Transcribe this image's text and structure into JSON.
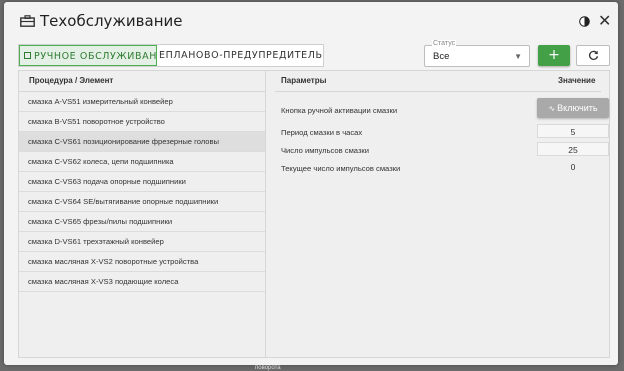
{
  "dialog": {
    "title": "Техобслуживание",
    "close_label": "✕"
  },
  "tabs": {
    "manual": "Ручное обслуживание",
    "planned": "еПЛАНОВО-ПРЕДУПРЕДИТЕЛЬНОЕ"
  },
  "status_filter": {
    "legend": "Статус",
    "value": "Все"
  },
  "toolbar": {
    "add_label": "+"
  },
  "left_table": {
    "header": "Процедура / Элемент",
    "selected_index": 2,
    "rows": [
      "смазка А-VS51 измерительный конвейер",
      "смазка В-VS51 поворотное устройство",
      "смазка С-VS61 позиционирование фрезерные головы",
      "смазка С-VS62 колеса, цепи подшипника",
      "смазка С-VS63 подача опорные подшипники",
      "смазка С-VS64 SE/вытягивание опорные подшипники",
      "смазка С-VS65 фрезы/пилы подшипники",
      "смазка D-VS61 трехэтажный конвейер",
      "смазка масляная X-VS2 поворотные устройства",
      "смазка масляная X-VS3 подающие колеса"
    ]
  },
  "right_table": {
    "header_param": "Параметры",
    "header_value": "Значение",
    "rows": [
      {
        "label": "Кнопка ручной активации смазки",
        "button": "Включить"
      },
      {
        "label": "Период смазки в часах",
        "value": "5"
      },
      {
        "label": "Число импульсов смазки",
        "value": "25"
      },
      {
        "label": "Текущее число импульсов смазки",
        "value": "0"
      }
    ]
  },
  "footer_fragment": "поворота",
  "colors": {
    "accent_green": "#43a047",
    "tab_active_text": "#2e7d32",
    "button_grey": "#a9a9a9"
  },
  "icons": {
    "title": "toolbox-icon",
    "theme": "half-circle-icon",
    "close": "close-icon",
    "tab": "square-icon",
    "refresh": "refresh-icon",
    "activate": "wave-icon"
  }
}
